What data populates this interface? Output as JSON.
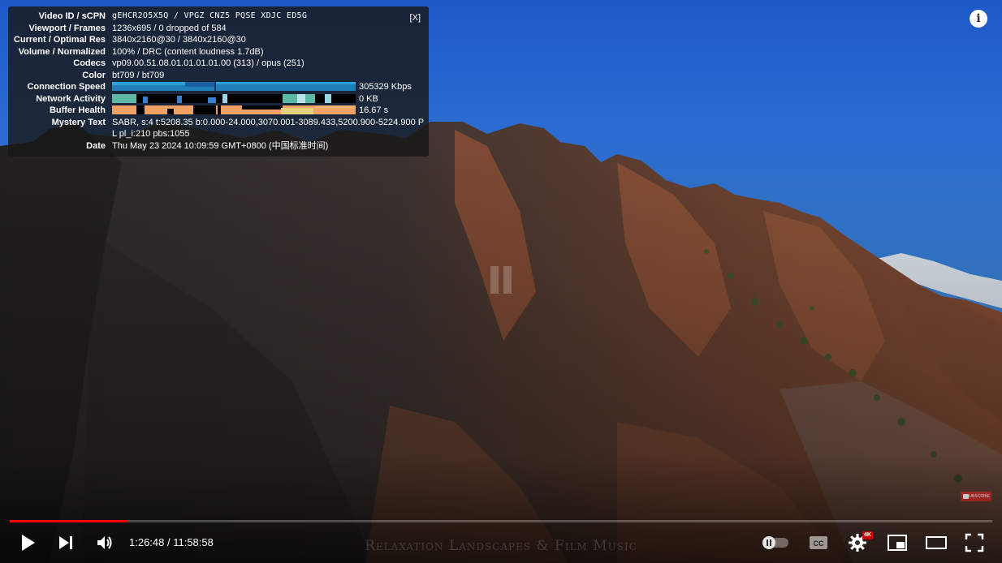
{
  "stats": {
    "close_label": "[X]",
    "rows": [
      {
        "label": "Video ID / sCPN",
        "value": "gEHCR2O5X5Q  /  VPGZ  CNZ5  PQSE  XDJC  ED5G"
      },
      {
        "label": "Viewport / Frames",
        "value": "1236x695 / 0 dropped of 584"
      },
      {
        "label": "Current / Optimal Res",
        "value": "3840x2160@30 / 3840x2160@30"
      },
      {
        "label": "Volume / Normalized",
        "value": "100% / DRC (content loudness 1.7dB)"
      },
      {
        "label": "Codecs",
        "value": "vp09.00.51.08.01.01.01.01.00 (313) / opus (251)"
      },
      {
        "label": "Color",
        "value": "bt709 / bt709"
      },
      {
        "label": "Connection Speed",
        "value": "305329 Kbps"
      },
      {
        "label": "Network Activity",
        "value": "0 KB"
      },
      {
        "label": "Buffer Health",
        "value": "16.67 s"
      },
      {
        "label": "Mystery Text",
        "value": "SABR, s:4 t:5208.35 b:0.000-24.000,3070.001-3089.433,5200.900-5224.900 P L pl_i:210 pbs:1055"
      },
      {
        "label": "Date",
        "value": "Thu May 23 2024 10:09:59 GMT+0800 (中国标准时间)"
      }
    ]
  },
  "player": {
    "time_display": "1:26:48 / 11:58:58",
    "current_time": "1:26:48",
    "duration": "11:58:58",
    "progress_fraction": 0.12,
    "quality_badge": "4K",
    "watermark": "Relaxation Landscapes & Film Music",
    "accent_color": "#ff0000",
    "is_paused": true
  },
  "icons": {
    "play": "play-icon",
    "next": "next-icon",
    "volume": "volume-icon",
    "autoplay": "autoplay-toggle-icon",
    "cc": "cc-icon",
    "settings": "gear-icon",
    "miniplayer": "miniplayer-icon",
    "theater": "theater-icon",
    "fullscreen": "fullscreen-icon",
    "info": "info-icon",
    "subscribe": "subscribe-badge"
  }
}
